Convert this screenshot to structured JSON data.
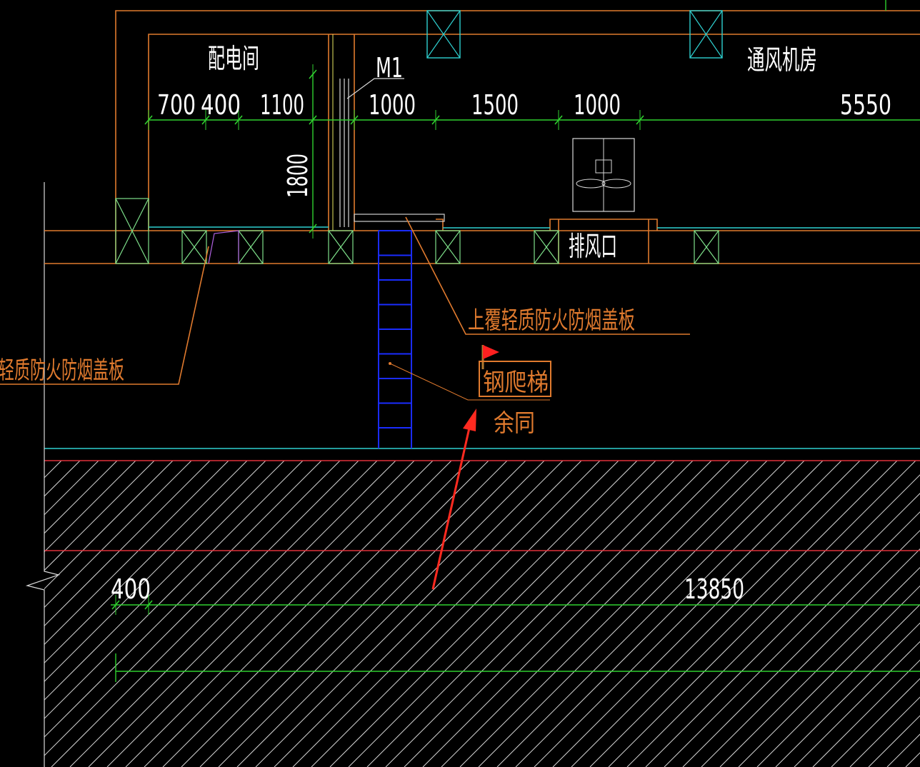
{
  "labels": {
    "room_power": "配电间",
    "room_ventilation": "通风机房",
    "door_tag": "M1",
    "exhaust_outlet": "排风口",
    "cover_plate_right": "上覆轻质防火防烟盖板",
    "cover_plate_left": "轻质防火防烟盖板",
    "steel_ladder": "钢爬梯",
    "same_elsewhere": "余同"
  },
  "dimensions": {
    "top": [
      "700",
      "400",
      "1100",
      "1000",
      "1500",
      "1000",
      "5550"
    ],
    "vertical": "1800",
    "bottom_left": "400",
    "bottom_main": "13850"
  },
  "colors": {
    "background": "#000000",
    "wall": "#e07a2e",
    "cyan_line": "#2fd0d0",
    "dimension_line": "#2fd02f",
    "ladder": "#1a2cff",
    "slab_boundary": "#e0303a",
    "arrow": "#ff2a20",
    "flag": "#ff2020"
  }
}
